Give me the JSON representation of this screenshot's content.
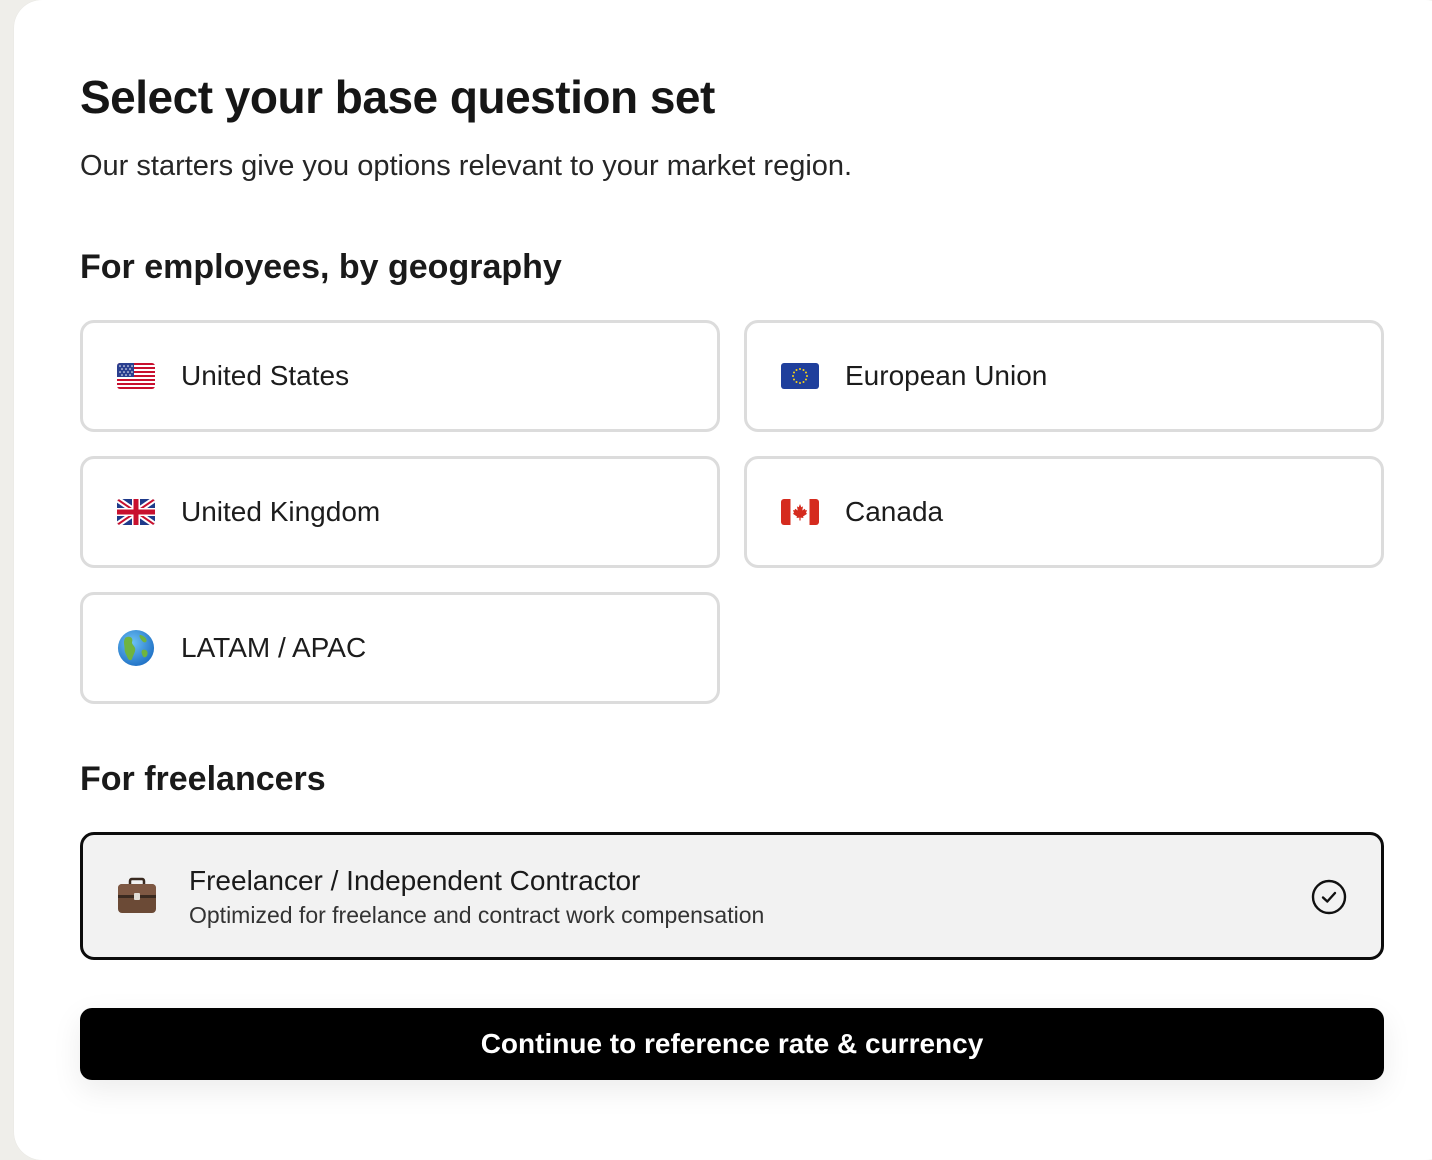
{
  "page": {
    "title": "Select your base question set",
    "subtitle": "Our starters give you options relevant to your market region."
  },
  "employees": {
    "heading": "For employees, by geography",
    "options": [
      {
        "label": "United States",
        "icon": "us-flag-icon"
      },
      {
        "label": "European Union",
        "icon": "eu-flag-icon"
      },
      {
        "label": "United Kingdom",
        "icon": "uk-flag-icon"
      },
      {
        "label": "Canada",
        "icon": "canada-flag-icon"
      },
      {
        "label": "LATAM / APAC",
        "icon": "globe-icon"
      }
    ]
  },
  "freelancers": {
    "heading": "For freelancers",
    "option": {
      "title": "Freelancer / Independent Contractor",
      "description": "Optimized for freelance and contract work compensation",
      "icon": "briefcase-icon",
      "selected": true
    }
  },
  "actions": {
    "continue_label": "Continue to reference rate & currency"
  },
  "colors": {
    "accent": "#000000",
    "selected_bg": "#f2f2f2",
    "border": "#dcdcdc"
  }
}
